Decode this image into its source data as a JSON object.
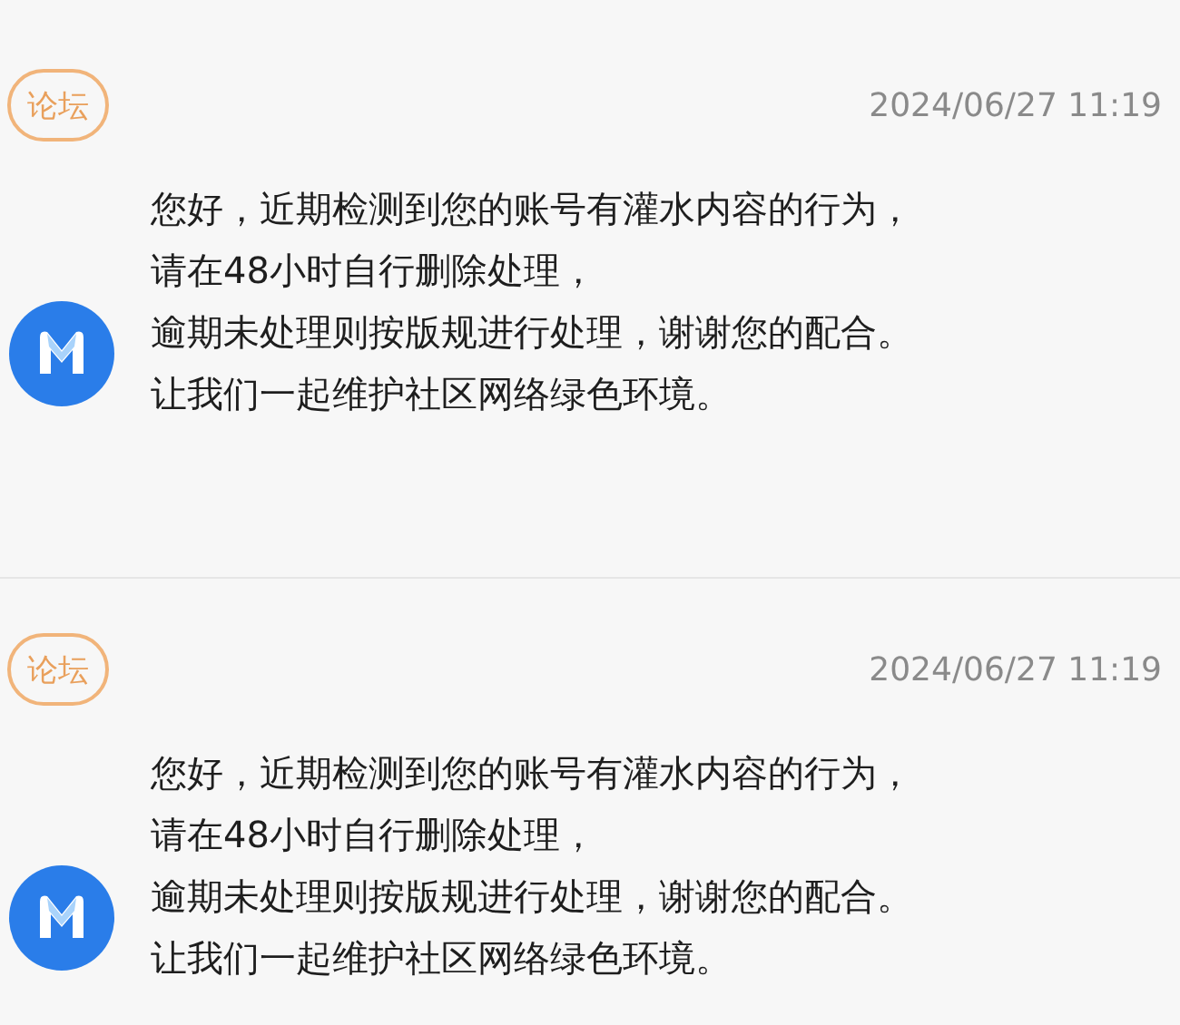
{
  "messages": [
    {
      "badge": "论坛",
      "time": "2024/06/27 11:19",
      "lines": [
        "您好，近期检测到您的账号有灌水内容的行为，",
        "请在48小时自行删除处理，",
        "逾期未处理则按版规进行处理，谢谢您的配合。",
        "让我们一起维护社区网络绿色环境。"
      ]
    },
    {
      "badge": "论坛",
      "time": "2024/06/27 11:19",
      "lines": [
        "您好，近期检测到您的账号有灌水内容的行为，",
        "请在48小时自行删除处理，",
        "逾期未处理则按版规进行处理，谢谢您的配合。",
        "让我们一起维护社区网络绿色环境。"
      ]
    }
  ]
}
